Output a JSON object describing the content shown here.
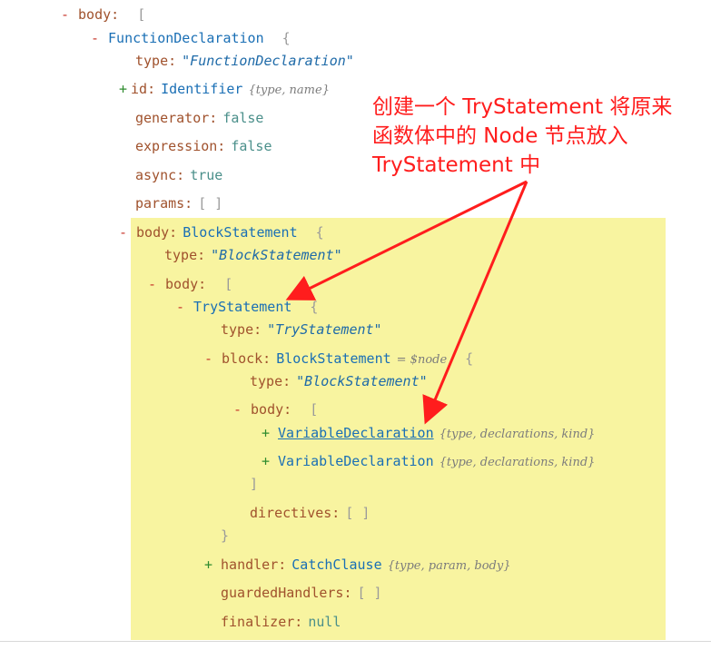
{
  "tree": {
    "minus": "-",
    "plus": "+",
    "body_key": "body:",
    "open_bracket": "[",
    "close_bracket": "]",
    "open_brace": "{",
    "close_brace": "}",
    "function_declaration": "FunctionDeclaration",
    "type_key": "type:",
    "function_declaration_type": "\"FunctionDeclaration\"",
    "id_key": "id:",
    "identifier": "Identifier",
    "identifier_meta": "{type, name}",
    "generator_key": "generator:",
    "expression_key": "expression:",
    "async_key": "async:",
    "false_value": "false",
    "true_value": "true",
    "params_key": "params:",
    "empty_array": "[ ]",
    "block_statement": "BlockStatement",
    "block_statement_type": "\"BlockStatement\"",
    "try_statement": "TryStatement",
    "try_statement_type": "\"TryStatement\"",
    "block_key": "block:",
    "node_ref": "= $node",
    "variable_declaration": "VariableDeclaration",
    "variable_declaration_meta": "{type, declarations, kind}",
    "directives_key": "directives:",
    "handler_key": "handler:",
    "catch_clause": "CatchClause",
    "catch_clause_meta": "{type, param, body}",
    "guarded_handlers_key": "guardedHandlers:",
    "finalizer_key": "finalizer:",
    "null_value": "null"
  },
  "annotation": {
    "line1": "创建一个 TryStatement 将原来",
    "line2": "函数体中的 Node 节点放入",
    "line3": "TryStatement 中",
    "color": "#ff1d1d"
  },
  "colors": {
    "highlight": "#f8f4a0",
    "key": "#a0522d",
    "node_type": "#1a6fb5",
    "minus": "#c8382d",
    "plus": "#2e8b2e"
  }
}
